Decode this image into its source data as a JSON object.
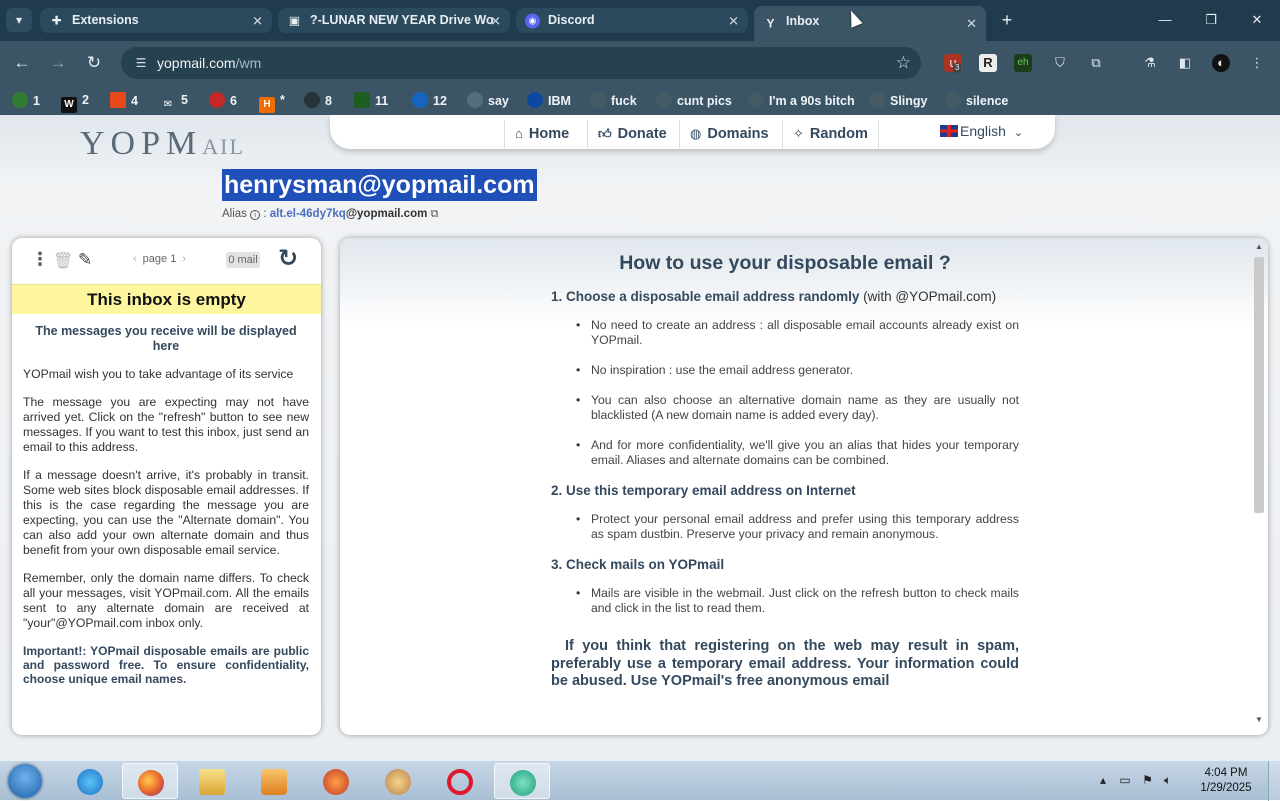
{
  "browser": {
    "tabs": [
      {
        "title": "Extensions",
        "icon": "puzzle-icon",
        "state": "inactive"
      },
      {
        "title": "?-LUNAR NEW YEAR Drive Wo",
        "icon": "page-icon",
        "state": "inactive"
      },
      {
        "title": "Discord",
        "icon": "discord-icon",
        "state": "inactive"
      },
      {
        "title": "Inbox",
        "icon": "yopmail-icon",
        "state": "active"
      }
    ],
    "url_host": "yopmail.com",
    "url_path": "/wm",
    "ext_badge": "3",
    "bookmarks": [
      {
        "label": "1",
        "color": "#2e7d32"
      },
      {
        "label": "2",
        "color": "#111111"
      },
      {
        "label": "4",
        "color": "#e64a19"
      },
      {
        "label": "5",
        "color": "#37474f"
      },
      {
        "label": "6",
        "color": "#c62828"
      },
      {
        "label": "*",
        "color": "#ef6c00"
      },
      {
        "label": "8",
        "color": "#263238"
      },
      {
        "label": "11",
        "color": "#1b5e20"
      },
      {
        "label": "12",
        "color": "#1565c0"
      },
      {
        "label": "say",
        "color": "#546e7a"
      },
      {
        "label": "IBM",
        "color": "#0d47a1"
      },
      {
        "label": "fuck",
        "color": "#455a64"
      },
      {
        "label": "cunt pics",
        "color": "#455a64"
      },
      {
        "label": "I'm a 90s bitch",
        "color": "#455a64"
      },
      {
        "label": "Slingy",
        "color": "#455a64"
      },
      {
        "label": "silence",
        "color": "#455a64"
      }
    ]
  },
  "site": {
    "logo_main": "YOPM",
    "logo_sub": "AIL",
    "nav": {
      "home": "Home",
      "donate": "Donate",
      "domains": "Domains",
      "random": "Random",
      "language": "English"
    },
    "email": "henrysman@yopmail.com",
    "alias_label": "Alias",
    "alias_value": "alt.el-46dy7kq",
    "alias_domain": "@yopmail.com"
  },
  "inbox": {
    "page_label": "page 1",
    "mail_count": "0 mail",
    "empty_title": "This inbox is empty",
    "subtitle": "The messages you receive will be displayed here",
    "para1": "YOPmail wish you to take advantage of its service",
    "para2": "The message you are expecting may not have arrived yet. Click on the \"refresh\" button to see new messages. If you want to test this inbox, just send an email to this address.",
    "para3": "If a message doesn't arrive, it's probably in transit. Some web sites block disposable email addresses. If this is the case regarding the message you are expecting, you can use the \"Alternate domain\". You can also add your own alternate domain and thus benefit from your own disposable email service.",
    "para4": "Remember, only the domain name differs. To check all your messages, visit YOPmail.com. All the emails sent to any alternate domain are received at \"your\"@YOPmail.com inbox only.",
    "important": "Important!: YOPmail disposable emails are public and password free. To ensure confidentiality, choose unique email names."
  },
  "help": {
    "title": "How to use your disposable email ?",
    "s1_title": "1. Choose a disposable email address randomly",
    "s1_note": "(with @YOPmail.com)",
    "s1_items": [
      "No need to create an address : all disposable email accounts already exist on YOPmail.",
      "No inspiration : use the email address generator.",
      "You can also choose an alternative domain name as they are usually not blacklisted (A new domain name is added every day).",
      "And for more confidentiality, we'll give you an alias that hides your temporary email. Aliases and alternate domains can be combined."
    ],
    "s2_title": "2. Use this temporary email address on Internet",
    "s2_items": [
      "Protect your personal email address and prefer using this temporary address as spam dustbin. Preserve your privacy and remain anonymous."
    ],
    "s3_title": "3. Check mails on YOPmail",
    "s3_items": [
      "Mails are visible in the webmail. Just click on the refresh button to check mails and click in the list to read them."
    ],
    "warning": "If you think that registering on the web may result in spam, preferably use a temporary email address. Your information could be abused. Use YOPmail's free anonymous email"
  },
  "taskbar": {
    "time": "4:04 PM",
    "date": "1/29/2025"
  }
}
